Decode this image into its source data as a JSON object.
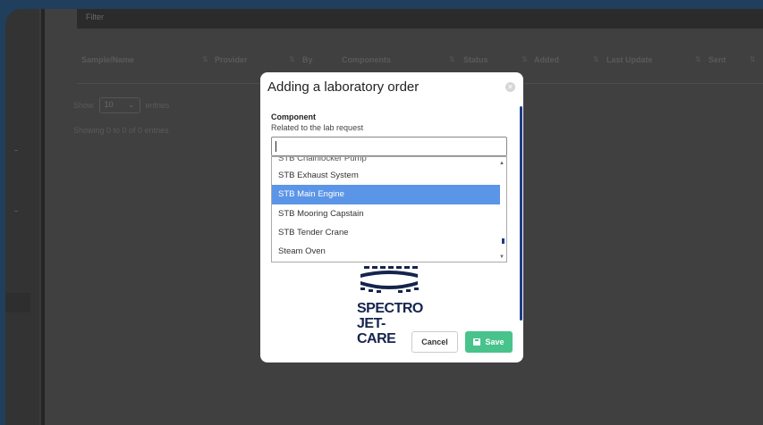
{
  "background": {
    "filter_label": "Filter",
    "table_headers": [
      "Sample/Name",
      "Provider",
      "By",
      "Components",
      "Status",
      "Added",
      "Last Update",
      "Sent"
    ],
    "show_label": "Show",
    "show_value": "10",
    "entries_label": "entries",
    "showing_text": "Showing 0 to 0 of 0 entries"
  },
  "modal": {
    "title": "Adding a laboratory order",
    "close_glyph": "✕",
    "component_label": "Component",
    "component_sub": "Related to the lab request",
    "search_value": "",
    "options": [
      {
        "label": "STB Chainlocker Pump",
        "selected": false
      },
      {
        "label": "STB Exhaust System",
        "selected": false
      },
      {
        "label": "STB Main Engine",
        "selected": true
      },
      {
        "label": "STB Mooring Capstain",
        "selected": false
      },
      {
        "label": "STB Tender Crane",
        "selected": false
      },
      {
        "label": "Steam Oven",
        "selected": false
      }
    ],
    "logo": {
      "line1": "SPECTRO",
      "line2": "JET-CARE"
    },
    "cancel_label": "Cancel",
    "save_label": "Save"
  },
  "colors": {
    "accent_select": "#5b95e7",
    "save_green": "#48c38b",
    "logo_navy": "#14244d"
  }
}
